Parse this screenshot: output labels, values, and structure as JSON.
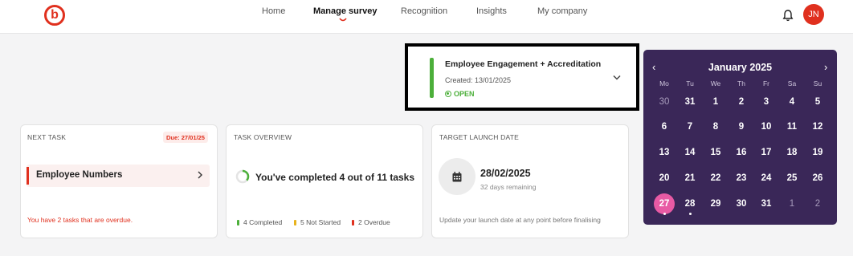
{
  "header": {
    "logo_letter": "b",
    "nav": [
      {
        "label": "Home"
      },
      {
        "label": "Manage survey"
      },
      {
        "label": "Recognition"
      },
      {
        "label": "Insights"
      },
      {
        "label": "My company"
      }
    ],
    "active_nav": "Manage survey",
    "avatar_initials": "JN",
    "icons": [
      "bell-icon"
    ]
  },
  "survey": {
    "title": "Employee Engagement + Accreditation",
    "created": "Created: 13/01/2025",
    "status": "OPEN",
    "status_color": "#4caf3a"
  },
  "next_task": {
    "title": "NEXT TASK",
    "due": "Due: 27/01/25",
    "task_label": "Employee Numbers",
    "overdue_text": "You have 2 tasks that are overdue."
  },
  "task_overview": {
    "title": "TASK OVERVIEW",
    "summary": "You've completed 4 out of 11 tasks",
    "completed": 4,
    "total": 11,
    "legend": [
      {
        "label": "4 Completed",
        "color": "#4caf3a"
      },
      {
        "label": "5 Not Started",
        "color": "#e8b31d"
      },
      {
        "label": "2 Overdue",
        "color": "#e0301e"
      }
    ]
  },
  "launch": {
    "title": "TARGET LAUNCH DATE",
    "date": "28/02/2025",
    "remaining": "32 days remaining",
    "note": "Update your launch date at any point before finalising"
  },
  "calendar": {
    "month": "January",
    "year": "2025",
    "prev": "‹",
    "next": "›",
    "weekdays": [
      "Mo",
      "Tu",
      "We",
      "Th",
      "Fr",
      "Sa",
      "Su"
    ],
    "weeks": [
      [
        {
          "d": "30",
          "muted": true
        },
        {
          "d": "31",
          "muted": false
        },
        {
          "d": "1"
        },
        {
          "d": "2"
        },
        {
          "d": "3"
        },
        {
          "d": "4"
        },
        {
          "d": "5"
        }
      ],
      [
        {
          "d": "6"
        },
        {
          "d": "7"
        },
        {
          "d": "8"
        },
        {
          "d": "9"
        },
        {
          "d": "10"
        },
        {
          "d": "11"
        },
        {
          "d": "12"
        }
      ],
      [
        {
          "d": "13"
        },
        {
          "d": "14"
        },
        {
          "d": "15"
        },
        {
          "d": "16"
        },
        {
          "d": "17"
        },
        {
          "d": "18"
        },
        {
          "d": "19"
        }
      ],
      [
        {
          "d": "20"
        },
        {
          "d": "21"
        },
        {
          "d": "22"
        },
        {
          "d": "23"
        },
        {
          "d": "24"
        },
        {
          "d": "25"
        },
        {
          "d": "26"
        }
      ],
      [
        {
          "d": "27",
          "selected": true,
          "dot": true
        },
        {
          "d": "28",
          "dot": true
        },
        {
          "d": "29"
        },
        {
          "d": "30"
        },
        {
          "d": "31"
        },
        {
          "d": "1",
          "muted": true
        },
        {
          "d": "2",
          "muted": true
        }
      ]
    ],
    "background": "#3a2758",
    "selected_color": "#e85aa4"
  }
}
